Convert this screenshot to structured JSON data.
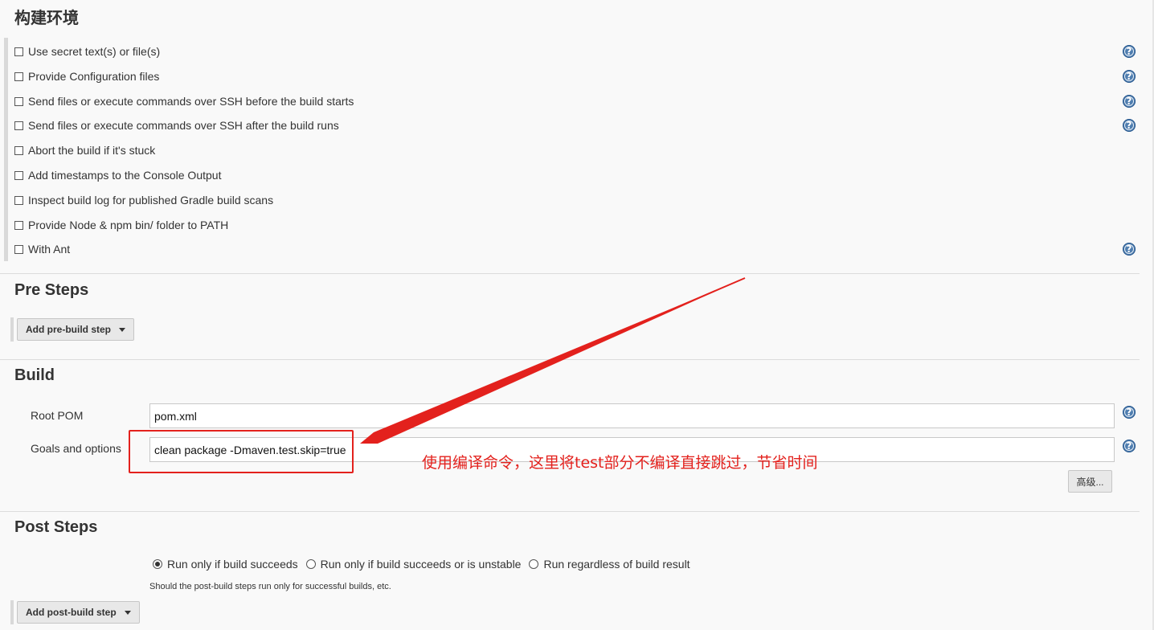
{
  "env_section": {
    "title": "构建环境",
    "options": [
      {
        "label": "Use secret text(s) or file(s)",
        "checked": false,
        "help": true
      },
      {
        "label": "Provide Configuration files",
        "checked": false,
        "help": true
      },
      {
        "label": "Send files or execute commands over SSH before the build starts",
        "checked": false,
        "help": true
      },
      {
        "label": "Send files or execute commands over SSH after the build runs",
        "checked": false,
        "help": true
      },
      {
        "label": "Abort the build if it's stuck",
        "checked": false,
        "help": false
      },
      {
        "label": "Add timestamps to the Console Output",
        "checked": false,
        "help": false
      },
      {
        "label": "Inspect build log for published Gradle build scans",
        "checked": false,
        "help": false
      },
      {
        "label": "Provide Node & npm bin/ folder to PATH",
        "checked": false,
        "help": false
      },
      {
        "label": "With Ant",
        "checked": false,
        "help": true
      }
    ]
  },
  "pre_steps": {
    "title": "Pre Steps",
    "add_button": "Add pre-build step"
  },
  "build": {
    "title": "Build",
    "root_pom_label": "Root POM",
    "root_pom_value": "pom.xml",
    "goals_label": "Goals and options",
    "goals_value": "clean package -Dmaven.test.skip=true",
    "advanced_button": "高级..."
  },
  "annotation": {
    "text": "使用编译命令，这里将test部分不编译直接跳过，节省时间",
    "color": "#e3211d"
  },
  "post_steps": {
    "title": "Post Steps",
    "radios": [
      {
        "label": "Run only if build succeeds",
        "checked": true
      },
      {
        "label": "Run only if build succeeds or is unstable",
        "checked": false
      },
      {
        "label": "Run regardless of build result",
        "checked": false
      }
    ],
    "note": "Should the post-build steps run only for successful builds, etc.",
    "add_button": "Add post-build step"
  },
  "icons": {
    "help": "help-question-icon",
    "dropdown": "caret-down-icon"
  },
  "colors": {
    "background": "#f9f9f9",
    "help_icon": "#4f7eb0",
    "annotation_red": "#e3211d"
  }
}
